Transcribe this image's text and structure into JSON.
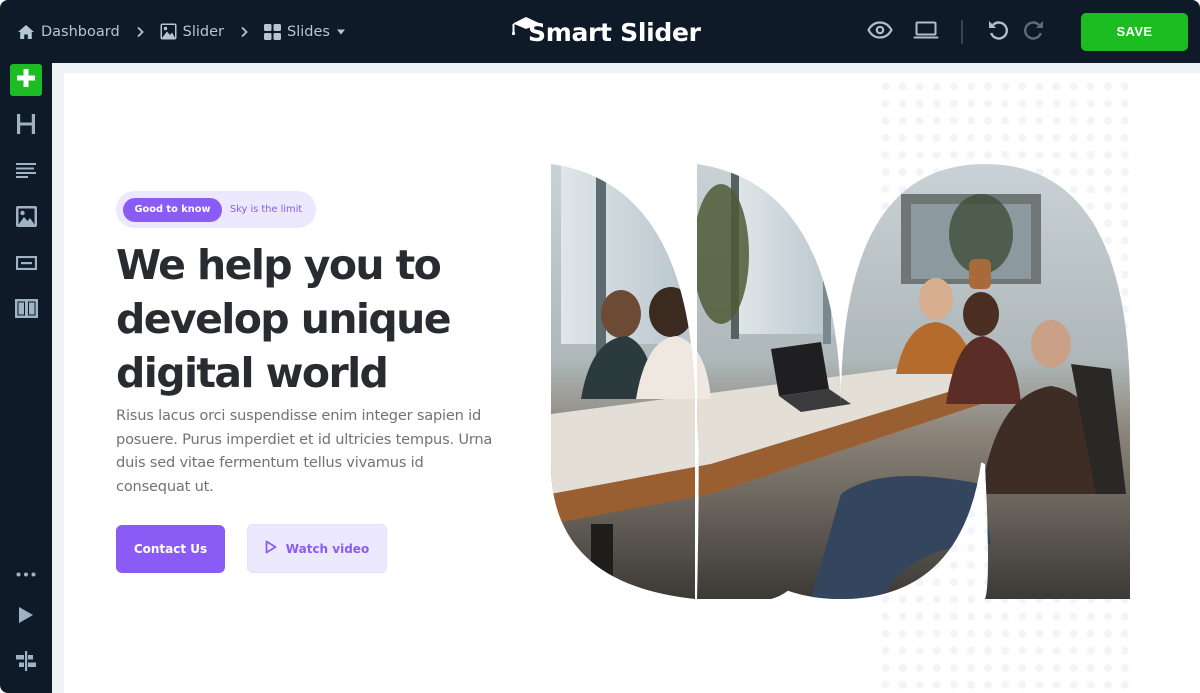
{
  "topbar": {
    "breadcrumb": [
      {
        "label": "Dashboard",
        "icon": "home-icon"
      },
      {
        "label": "Slider",
        "icon": "image-icon"
      },
      {
        "label": "Slides",
        "icon": "grid-icon",
        "dropdown": true
      }
    ],
    "logo_text": "Smart Slider",
    "actions": {
      "preview_icon": "eye-icon",
      "device_icon": "laptop-icon",
      "undo_icon": "undo-icon",
      "redo_icon": "redo-icon",
      "save_label": "SAVE"
    }
  },
  "sidebar": {
    "items": [
      {
        "name": "add-layer",
        "icon": "plus-icon"
      },
      {
        "name": "heading",
        "icon": "heading-icon"
      },
      {
        "name": "text",
        "icon": "text-align-icon"
      },
      {
        "name": "image",
        "icon": "image-icon"
      },
      {
        "name": "button",
        "icon": "button-icon"
      },
      {
        "name": "columns",
        "icon": "columns-icon"
      }
    ],
    "bottom_items": [
      {
        "name": "more",
        "icon": "more-dots-icon"
      },
      {
        "name": "play",
        "icon": "play-icon"
      },
      {
        "name": "align",
        "icon": "align-center-icon"
      }
    ]
  },
  "slide": {
    "badge_tag": "Good to know",
    "badge_text": "Sky is the limit",
    "headline_lines": [
      "We help you to",
      "develop unique",
      "digital world"
    ],
    "body": "Risus lacus orci suspendisse enim integer sapien id posuere. Purus imperdiet et id ultricies tempus. Urna duis sed vitae fermentum tellus vivamus id consequat ut.",
    "primary_button": "Contact Us",
    "secondary_button": "Watch video",
    "image_alt": "Team meeting around a wooden conference table"
  },
  "colors": {
    "accent": "#8a5cf5",
    "save_green": "#1bbd23",
    "topbar_bg": "#0e1a27",
    "heading": "#2a2b31"
  }
}
